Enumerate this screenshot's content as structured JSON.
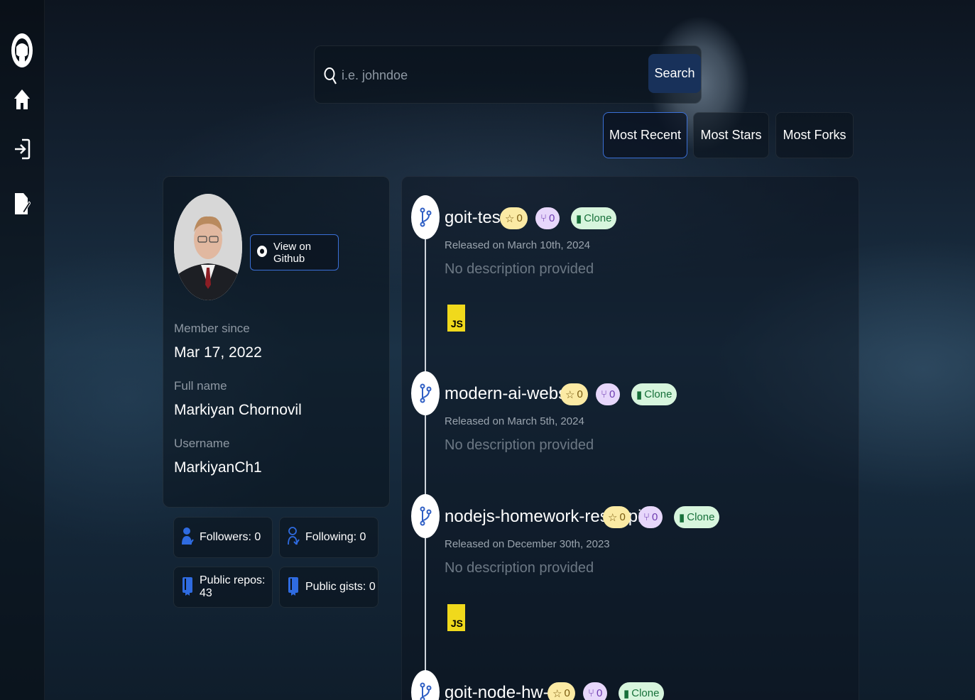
{
  "sidebar": {
    "items": [
      {
        "icon": "github-logo-icon"
      },
      {
        "icon": "home-icon"
      },
      {
        "icon": "login-icon"
      },
      {
        "icon": "signup-edit-icon"
      }
    ]
  },
  "search": {
    "placeholder": "i.e. johndoe",
    "value": "",
    "button_label": "Search"
  },
  "sort": {
    "options": [
      "Most Recent",
      "Most Stars",
      "Most Forks"
    ],
    "active": "Most Recent"
  },
  "profile": {
    "view_button_label": "View on Github",
    "member_since_label": "Member since",
    "member_since": "Mar 17, 2022",
    "full_name_label": "Full name",
    "full_name": "Markiyan Chornovil",
    "username_label": "Username",
    "username": "MarkiyanCh1"
  },
  "stats": {
    "followers": "Followers: 0",
    "following": "Following: 0",
    "public_repos": "Public repos: 43",
    "public_gists": "Public gists: 0"
  },
  "repos": [
    {
      "name": "goit-test",
      "stars": "0",
      "forks": "0",
      "clone_label": "Clone",
      "released": "Released on March 10th, 2024",
      "description": "No description provided",
      "language": "JS"
    },
    {
      "name": "modern-ai-website",
      "stars": "0",
      "forks": "0",
      "clone_label": "Clone",
      "released": "Released on March 5th, 2024",
      "description": "No description provided",
      "language": ""
    },
    {
      "name": "nodejs-homework-rest-api",
      "stars": "0",
      "forks": "0",
      "clone_label": "Clone",
      "released": "Released on December 30th, 2023",
      "description": "No description provided",
      "language": "JS"
    },
    {
      "name": "goit-node-hw-01",
      "stars": "0",
      "forks": "0",
      "clone_label": "Clone",
      "released": "",
      "description": "",
      "language": ""
    }
  ],
  "colors": {
    "accent": "#3a6fd6",
    "search_button": "#18315a",
    "star_badge": "#fbeaa4",
    "fork_badge": "#e7d7fb",
    "clone_badge": "#d7f5dd",
    "js_badge": "#f0d91c"
  }
}
